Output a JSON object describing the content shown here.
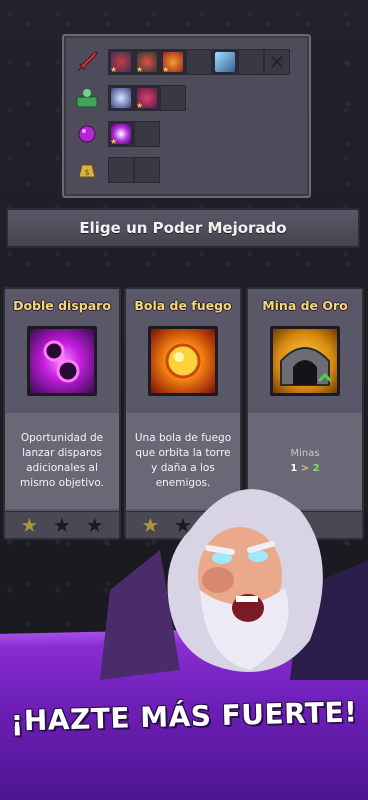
{
  "inventory": {
    "rows": [
      {
        "category_icon": "sword-icon",
        "slots": [
          "wizard-hat",
          "crossbow",
          "fireball",
          "empty",
          "ice-shard",
          "empty",
          "locked"
        ]
      },
      {
        "category_icon": "spellbook-icon",
        "slots": [
          "lightning",
          "rose-orb",
          "empty"
        ]
      },
      {
        "category_icon": "magic-orb-icon",
        "slots": [
          "magic-burst",
          "empty"
        ]
      },
      {
        "category_icon": "coin-bag-icon",
        "slots": [
          "empty",
          "empty"
        ]
      }
    ]
  },
  "banner": {
    "title": "Elige un Poder Mejorado"
  },
  "cards": [
    {
      "title": "Doble disparo",
      "art_icon": "double-shot-icon",
      "description": "Oportunidad de lanzar disparos adicionales al mismo objetivo.",
      "stars": [
        "gold",
        "dark",
        "dark"
      ]
    },
    {
      "title": "Bola de fuego",
      "art_icon": "fireball-icon",
      "description": "Una bola de fuego que orbita la torre y daña a los enemigos.",
      "stars": [
        "gold",
        "dark",
        "dark"
      ]
    },
    {
      "title": "Mina de Oro",
      "art_icon": "gold-mine-icon",
      "stat_label": "Minas",
      "stat_from": "1",
      "stat_arrow": ">",
      "stat_to": "2"
    }
  ],
  "slogan": "¡HAZTE MÁS FUERTE!",
  "colors": {
    "accent_purple": "#8a2fd2",
    "title_gold": "#f5d77a",
    "panel": "#5a5868"
  }
}
